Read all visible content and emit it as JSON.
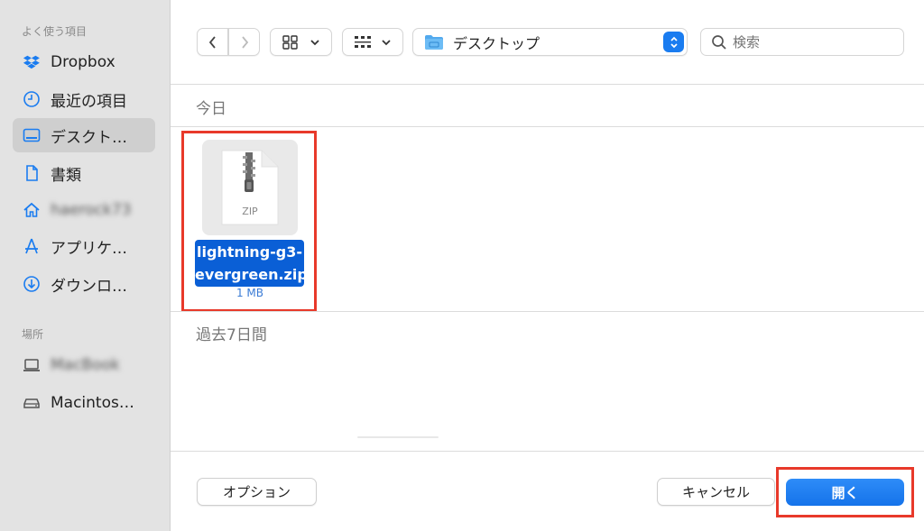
{
  "sidebar": {
    "favorites_header": "よく使う項目",
    "locations_header": "場所",
    "items": [
      {
        "label": "Dropbox",
        "icon": "dropbox-icon"
      },
      {
        "label": "最近の項目",
        "icon": "clock-icon"
      },
      {
        "label": "デスクト…",
        "icon": "desktop-icon",
        "selected": true
      },
      {
        "label": "書類",
        "icon": "document-icon"
      },
      {
        "label": "haerock73",
        "icon": "home-icon"
      },
      {
        "label": "アプリケ…",
        "icon": "applications-icon"
      },
      {
        "label": "ダウンロ…",
        "icon": "download-icon"
      }
    ],
    "locations": [
      {
        "label": "MacBook",
        "icon": "laptop-icon"
      },
      {
        "label": "Macintos…",
        "icon": "disk-icon"
      }
    ]
  },
  "toolbar": {
    "location": "デスクトップ",
    "search_placeholder": "検索"
  },
  "content": {
    "group_today": "今日",
    "group_past7": "過去7日間",
    "file": {
      "name": "lightning-g3-evergreen.zip",
      "name_line1": "lightning-g3-",
      "name_line2": "evergreen.zip",
      "type_label": "ZIP",
      "size": "1 MB"
    }
  },
  "footer": {
    "options_label": "オプション",
    "cancel_label": "キャンセル",
    "open_label": "開く"
  },
  "colors": {
    "accent": "#1a7cf0",
    "highlight": "#e8392a",
    "selection": "#0a5fd6"
  }
}
